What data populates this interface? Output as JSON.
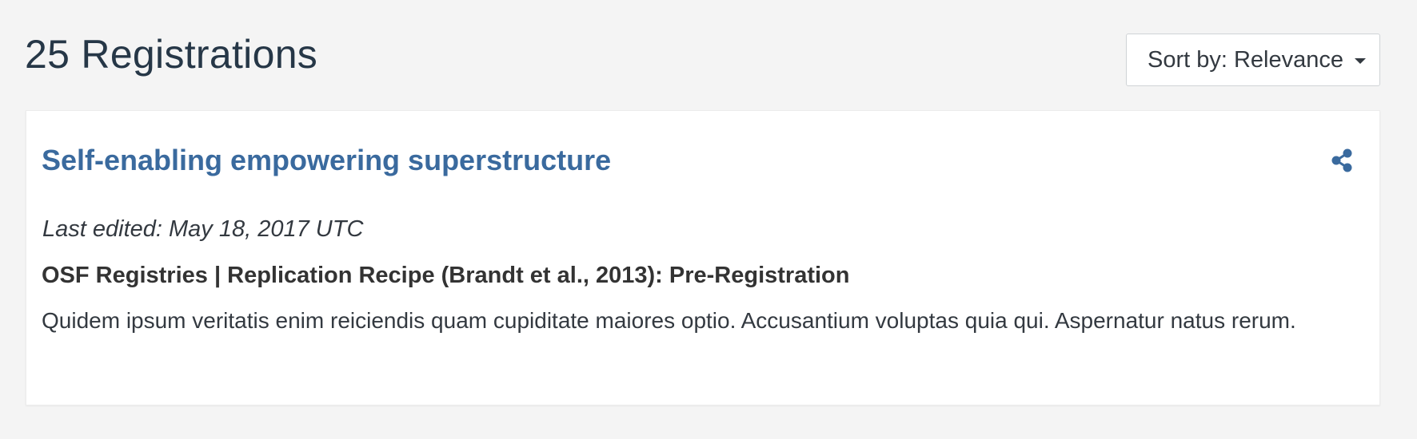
{
  "results": {
    "heading": "25 Registrations"
  },
  "sort": {
    "label": "Sort by: Relevance",
    "caret_icon": "caret-down-icon"
  },
  "result_card": {
    "title": "Self-enabling empowering superstructure",
    "share_icon": "share-icon",
    "last_edited": "Last edited: May 18, 2017 UTC",
    "provider_line": "OSF Registries | Replication Recipe (Brandt et al., 2013): Pre-Registration",
    "description": "Quidem ipsum veritatis enim reiciendis quam cupiditate maiores optio. Accusantium voluptas quia qui. Aspernatur natus rerum."
  },
  "colors": {
    "background": "#f4f4f4",
    "heading": "#263747",
    "link": "#3a6a9e",
    "text": "#333940"
  }
}
